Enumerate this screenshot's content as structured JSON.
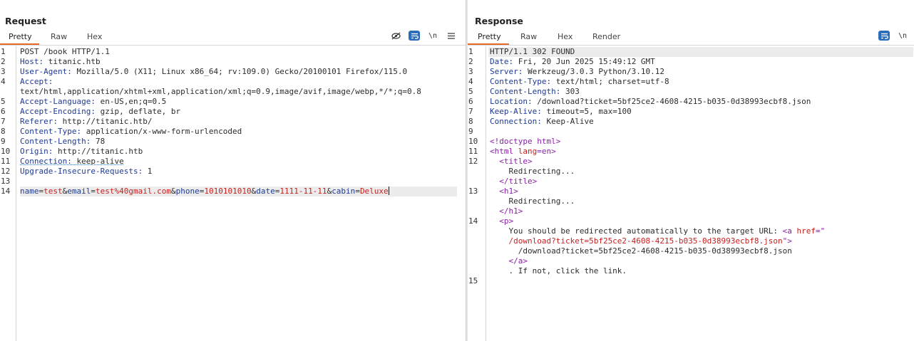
{
  "request": {
    "title": "Request",
    "tabs": [
      {
        "label": "Pretty"
      },
      {
        "label": "Raw"
      },
      {
        "label": "Hex"
      }
    ],
    "tools": {
      "hide_icon": "eye-slash-icon",
      "wrap_icon": "wrap-icon",
      "newline_label": "\\n",
      "menu_icon": "menu-icon"
    },
    "line_numbers": [
      "1",
      "2",
      "3",
      "4",
      "",
      "5",
      "6",
      "7",
      "8",
      "9",
      "10",
      "11",
      "12",
      "13",
      "14"
    ],
    "lines": {
      "l1": "POST /book HTTP/1.1",
      "l2k": "Host:",
      "l2v": " titanic.htb",
      "l3k": "User-Agent:",
      "l3v": " Mozilla/5.0 (X11; Linux x86_64; rv:109.0) Gecko/20100101 Firefox/115.0",
      "l4k": "Accept:",
      "l4v": "text/html,application/xhtml+xml,application/xml;q=0.9,image/avif,image/webp,*/*;q=0.8",
      "l5k": "Accept-Language:",
      "l5v": " en-US,en;q=0.5",
      "l6k": "Accept-Encoding:",
      "l6v": " gzip, deflate, br",
      "l7k": "Referer:",
      "l7v": " http://titanic.htb/",
      "l8k": "Content-Type:",
      "l8v": " application/x-www-form-urlencoded",
      "l9k": "Content-Length:",
      "l9v": " 78",
      "l10k": "Origin:",
      "l10v": " http://titanic.htb",
      "l11k": "Connection:",
      "l11v": " keep-alive",
      "l12k": "Upgrade-Insecure-Requests:",
      "l12v": " 1"
    },
    "body": {
      "k1": "name",
      "v1": "test",
      "k2": "email",
      "v2": "test%40gmail.com",
      "k3": "phone",
      "v3": "1010101010",
      "k4": "date",
      "v4": "1111-11-11",
      "k5": "cabin",
      "v5": "Deluxe",
      "eq": "=",
      "amp": "&"
    }
  },
  "response": {
    "title": "Response",
    "tabs": [
      {
        "label": "Pretty"
      },
      {
        "label": "Raw"
      },
      {
        "label": "Hex"
      },
      {
        "label": "Render"
      }
    ],
    "tools": {
      "wrap_icon": "wrap-icon",
      "newline_label": "\\n"
    },
    "line_numbers": [
      "1",
      "2",
      "3",
      "4",
      "5",
      "6",
      "7",
      "8",
      "9",
      "10",
      "11",
      "12",
      "13",
      "14",
      "15"
    ],
    "lines": {
      "l1": "HTTP/1.1 302 FOUND",
      "l2k": "Date:",
      "l2v": " Fri, 20 Jun 2025 15:49:12 GMT",
      "l3k": "Server:",
      "l3v": " Werkzeug/3.0.3 Python/3.10.12",
      "l4k": "Content-Type:",
      "l4v": " text/html; charset=utf-8",
      "l5k": "Content-Length:",
      "l5v": " 303",
      "l6k": "Location:",
      "l6v": " /download?ticket=5bf25ce2-4608-4215-b035-0d38993ecbf8.json",
      "l7k": "Keep-Alive:",
      "l7v": " timeout=5, max=100",
      "l8k": "Connection:",
      "l8v": " Keep-Alive",
      "l10": "<!doctype html>",
      "l11a": "<html ",
      "l11b": "lang",
      "l11c": "=en>",
      "l12a": "  <title>",
      "l12b": "    Redirecting...",
      "l12c": "  </title>",
      "l13a": "  <h1>",
      "l13b": "    Redirecting...",
      "l13c": "  </h1>",
      "l14a": "  <p>",
      "l14b": "    You should be redirected automatically to the target URL: ",
      "l14c": "<a ",
      "l14d": "href",
      "l14e": "=\"",
      "l14f": "    /download?ticket=5bf25ce2-4608-4215-b035-0d38993ecbf8.json",
      "l14g": "\">",
      "l14h": "      /download?ticket=5bf25ce2-4608-4215-b035-0d38993ecbf8.json",
      "l14i": "    </a>",
      "l14j": "    . If not, click the link."
    }
  },
  "layout_toggle": {
    "split_icon": "columns-icon",
    "stack_icon": "rows-icon"
  },
  "colors": {
    "accent": "#e8672a",
    "toggle_blue": "#2a6ebb",
    "header_key": "#1f3a93",
    "param_value": "#c81e1e",
    "tag": "#8a1ea8"
  }
}
